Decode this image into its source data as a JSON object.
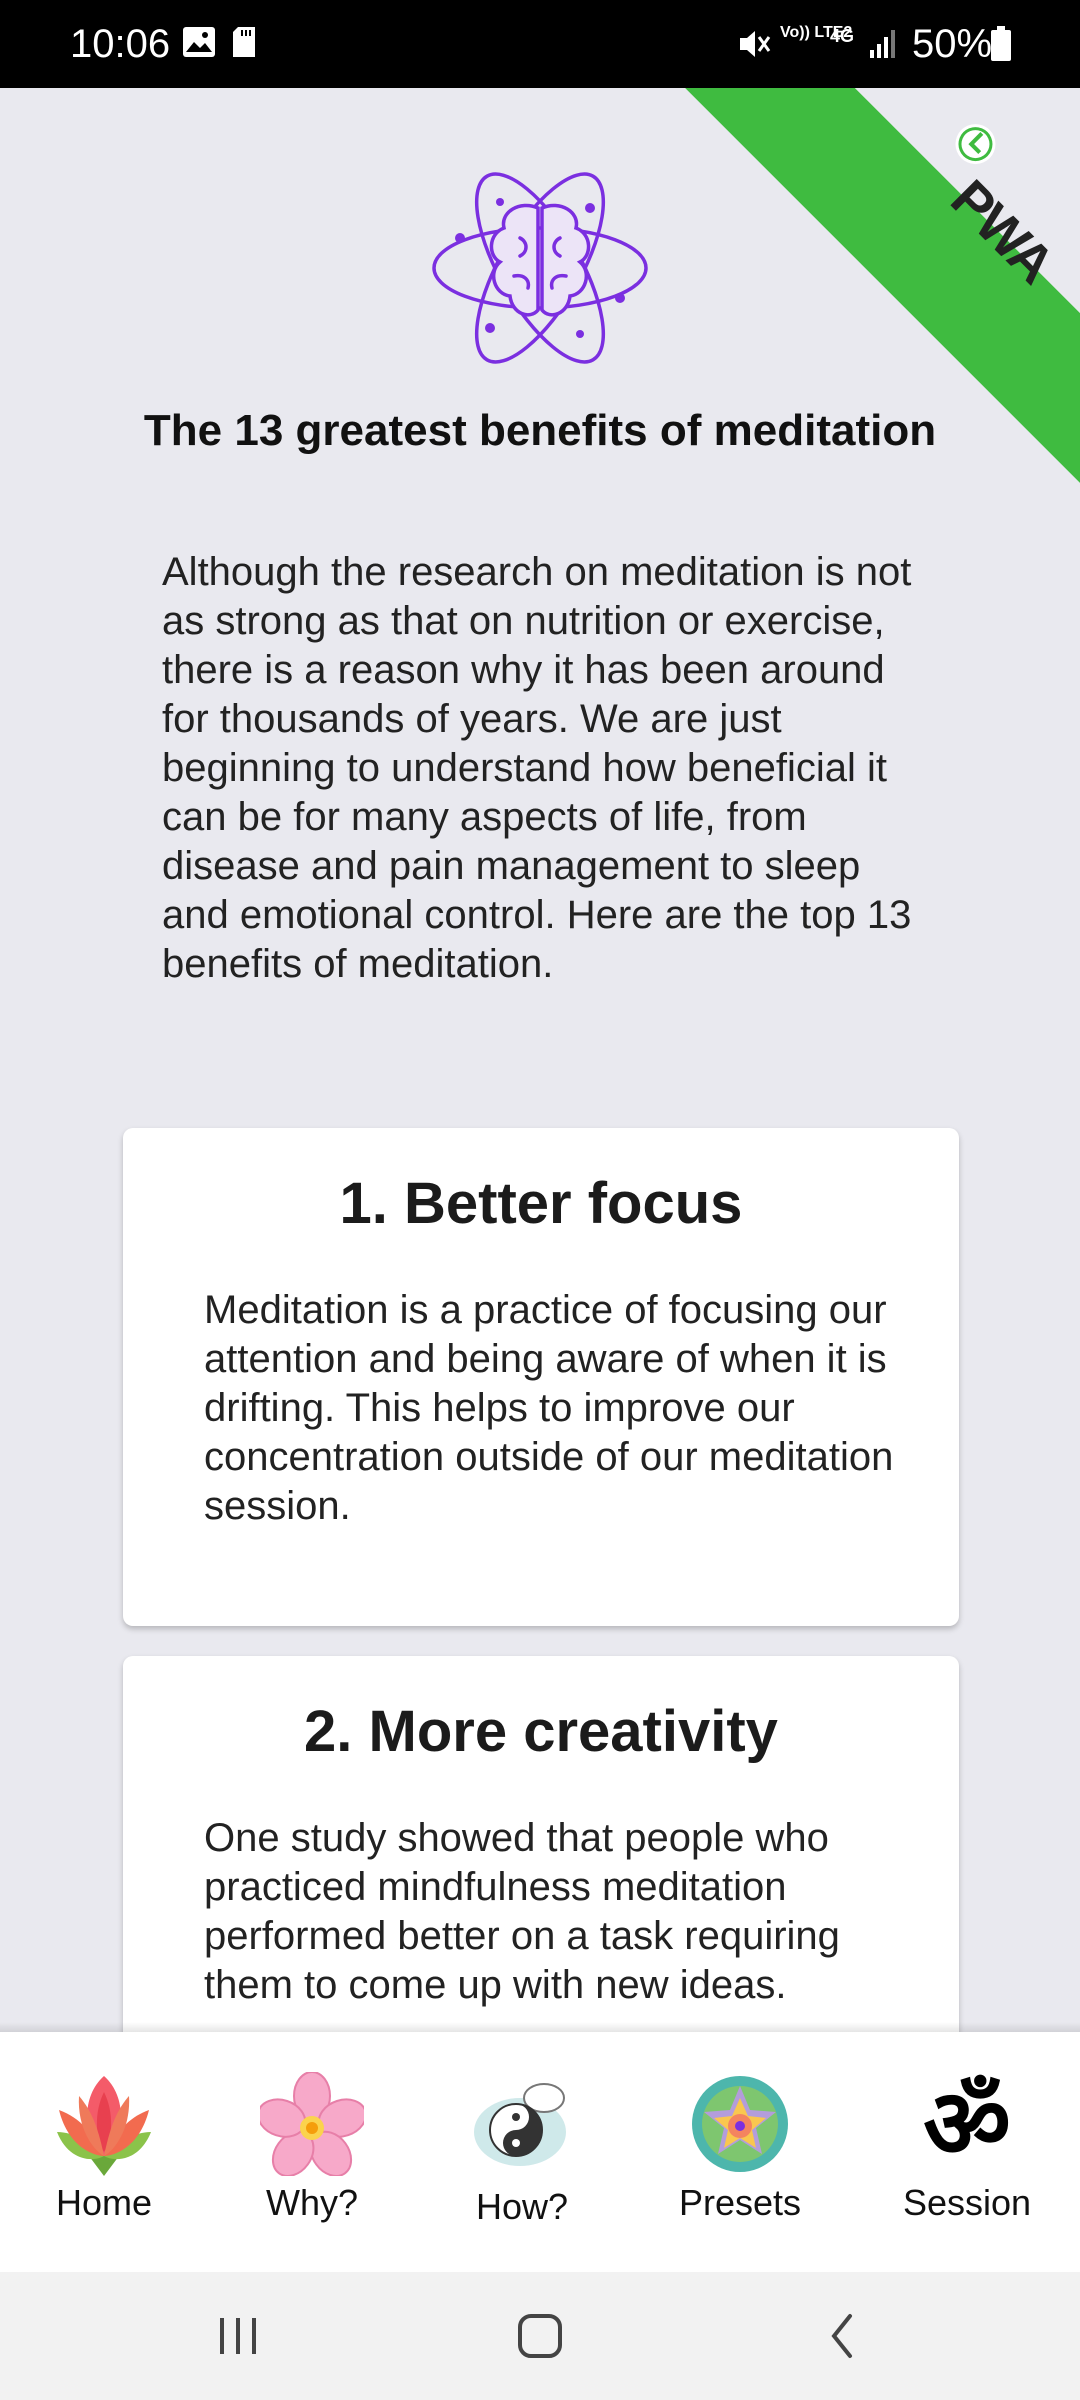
{
  "status_bar": {
    "time": "10:06",
    "battery": "50%",
    "network": "4G",
    "volte": "Vo)) LTE2"
  },
  "pwa_badge": "PWA",
  "page": {
    "title": "The 13 greatest benefits of meditation",
    "intro": "Although the research on meditation is not as strong as that on nutrition or exercise, there is a reason why it has been around for thousands of years. We are just beginning to understand how beneficial it can be for many aspects of life, from disease and pain management to sleep and emotional control. Here are the top 13 benefits of meditation."
  },
  "benefits": [
    {
      "title": "1. Better focus",
      "text": "Meditation is a practice of focusing our attention and being aware of when it is drifting. This helps to improve our concentration outside of our meditation session."
    },
    {
      "title": "2. More creativity",
      "text": "One study showed that people who practiced mindfulness meditation performed better on a task requiring them to come up with new ideas."
    }
  ],
  "bottom_nav": [
    {
      "label": "Home",
      "icon": "lotus-icon"
    },
    {
      "label": "Why?",
      "icon": "flower-icon"
    },
    {
      "label": "How?",
      "icon": "yin-yang-icon"
    },
    {
      "label": "Presets",
      "icon": "mandala-icon"
    },
    {
      "label": "Session",
      "icon": "om-icon"
    }
  ],
  "colors": {
    "accent_purple": "#7b2fe0",
    "pwa_green": "#3fbb40",
    "background": "#e9e9ef"
  }
}
